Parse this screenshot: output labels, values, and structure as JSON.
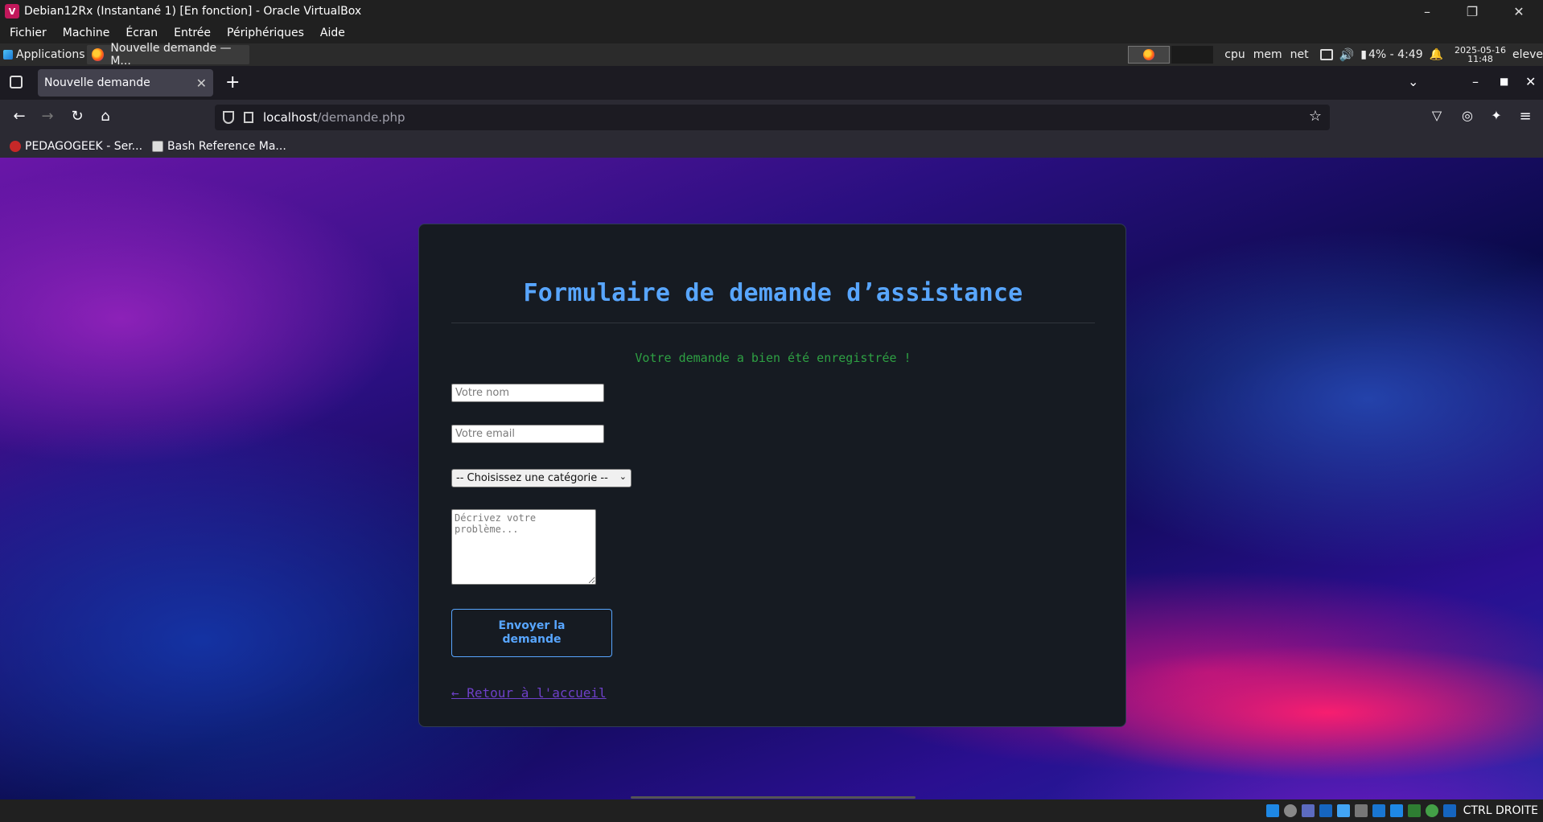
{
  "host": {
    "window_title": "Debian12Rx (Instantané 1) [En fonction] - Oracle VirtualBox",
    "menu": [
      "Fichier",
      "Machine",
      "Écran",
      "Entrée",
      "Périphériques",
      "Aide"
    ],
    "status_hostkey": "CTRL DROITE"
  },
  "panel": {
    "applications_label": "Applications",
    "task_label": "Nouvelle demande — M...",
    "monitors": [
      "cpu",
      "mem",
      "net"
    ],
    "battery": "4% - 4:49",
    "clock_date": "2025-05-16",
    "clock_time": "11:48",
    "user": "eleve"
  },
  "browser": {
    "tab_title": "Nouvelle demande",
    "url_host": "localhost",
    "url_path": "/demande.php",
    "bookmarks": [
      "PEDAGOGEEK - Ser...",
      "Bash Reference Ma..."
    ]
  },
  "form": {
    "title": "Formulaire de demande d’assistance",
    "success_message": "Votre demande a bien été enregistrée !",
    "name_placeholder": "Votre nom",
    "email_placeholder": "Votre email",
    "category_selected": "-- Choisissez une catégorie --",
    "description_placeholder": "Décrivez votre problème...",
    "submit_label": "Envoyer la demande",
    "back_link": "← Retour à l'accueil"
  },
  "colors": {
    "accent": "#58a6ff",
    "success": "#2ea043",
    "link": "#6e40c9",
    "card_bg": "#161b22"
  }
}
